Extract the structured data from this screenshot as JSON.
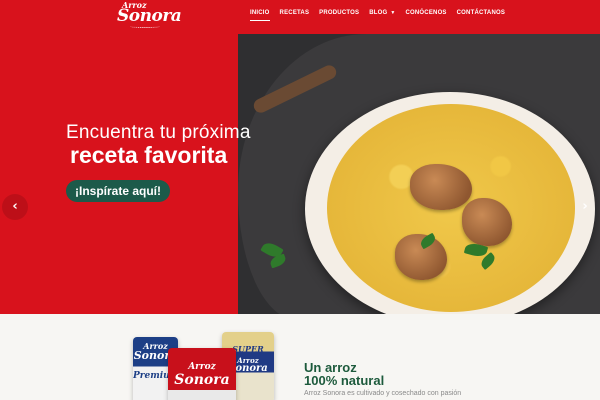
{
  "brand": {
    "logo_small": "Arroz",
    "logo_big": "Sonora",
    "color_primary": "#d8121c",
    "color_cta": "#1c5a4a",
    "color_section_title": "#1d5a3c"
  },
  "nav": {
    "items": [
      {
        "label": "INICIO",
        "active": true
      },
      {
        "label": "RECETAS"
      },
      {
        "label": "PRODUCTOS"
      },
      {
        "label": "BLOG",
        "dropdown": true
      },
      {
        "label": "CONÓCENOS"
      },
      {
        "label": "CONTÁCTANOS"
      }
    ]
  },
  "hero": {
    "headline_line1": "Encuentra tu próxima",
    "headline_line2": "receta favorita",
    "cta_label": "¡Inspírate aquí!",
    "prev_icon": "chevron-left-icon",
    "next_icon": "chevron-right-icon"
  },
  "products": {
    "bag1_brand": "Arroz",
    "bag1_name": "Sonora",
    "bag1_variant": "Premium",
    "bag2_brand": "Arroz",
    "bag2_name": "Sonora",
    "bag3_brand": "Arroz",
    "bag3_name": "Sonora",
    "bag3_variant": "SUPER"
  },
  "section": {
    "title_line1": "Un arroz",
    "title_line2": "100% natural",
    "text": "Arroz Sonora es cultivado y cosechado con pasión"
  }
}
